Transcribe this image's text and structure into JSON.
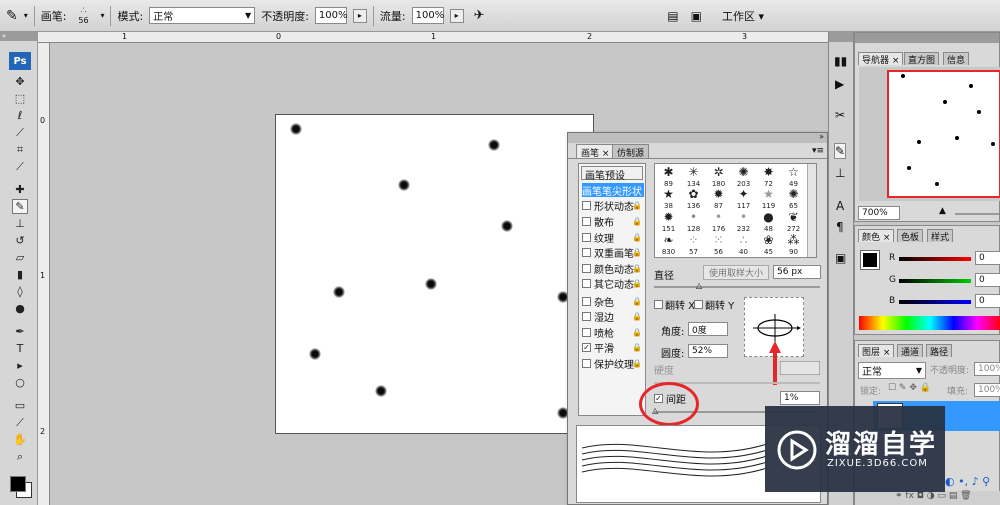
{
  "options_bar": {
    "brush_label": "画笔:",
    "brush_size": "56",
    "mode_label": "模式:",
    "mode_value": "正常",
    "opacity_label": "不透明度:",
    "opacity_value": "100%",
    "flow_label": "流量:",
    "flow_value": "100%",
    "workspace_label": "工作区 ▾"
  },
  "rulers": {
    "h_labels": [
      "1",
      "0",
      "1",
      "2",
      "3"
    ],
    "v_labels": [
      "0",
      "1",
      "2"
    ]
  },
  "toolbar": {
    "logo": "Ps",
    "tools": [
      "move-icon",
      "marquee-icon",
      "lasso-icon",
      "quick-select-icon",
      "crop-icon",
      "eyedropper-icon",
      "heal-icon",
      "brush-icon",
      "clone-stamp-icon",
      "history-brush-icon",
      "eraser-icon",
      "gradient-icon",
      "blur-icon",
      "dodge-icon",
      "pen-icon",
      "type-icon",
      "path-select-icon",
      "shape-icon",
      "notes-icon",
      "eyedropper2-icon",
      "hand-icon",
      "zoom-icon"
    ]
  },
  "brush_panel": {
    "tabs": [
      "画笔 ×",
      "仿制源"
    ],
    "preset_button": "画笔预设",
    "items": [
      {
        "label": "画笔笔尖形状",
        "checked": null,
        "selected": true
      },
      {
        "label": "形状动态",
        "checked": false
      },
      {
        "label": "散布",
        "checked": false
      },
      {
        "label": "纹理",
        "checked": false
      },
      {
        "label": "双重画笔",
        "checked": false
      },
      {
        "label": "颜色动态",
        "checked": false
      },
      {
        "label": "其它动态",
        "checked": false
      },
      {
        "label": "杂色",
        "checked": false
      },
      {
        "label": "湿边",
        "checked": false
      },
      {
        "label": "喷枪",
        "checked": false
      },
      {
        "label": "平滑",
        "checked": true
      },
      {
        "label": "保护纹理",
        "checked": false
      }
    ],
    "tips": [
      "89",
      "134",
      "180",
      "203",
      "72",
      "49",
      "38",
      "136",
      "87",
      "117",
      "119",
      "65",
      "151",
      "128",
      "176",
      "232",
      "48",
      "272",
      "830",
      "57",
      "56",
      "40",
      "45",
      "90"
    ],
    "diameter_label": "直径",
    "sample_size_button": "使用取样大小",
    "diameter_value": "56 px",
    "flip_x_label": "翻转 X",
    "flip_y_label": "翻转 Y",
    "angle_label": "角度:",
    "angle_value": "0度",
    "roundness_label": "圆度:",
    "roundness_value": "52%",
    "hardness_label": "硬度",
    "spacing_label": "间距",
    "spacing_checked": true,
    "spacing_value": "1%"
  },
  "navigator": {
    "tabs": [
      "导航器 ×",
      "直方图",
      "信息"
    ],
    "zoom": "700%"
  },
  "color_panel": {
    "tabs": [
      "颜色 ×",
      "色板",
      "样式"
    ],
    "r_label": "R",
    "g_label": "G",
    "b_label": "B",
    "r_value": "0",
    "g_value": "0",
    "b_value": "0"
  },
  "layers_panel": {
    "tabs": [
      "图层 ×",
      "通道",
      "路径"
    ],
    "blend_mode": "正常",
    "opacity_label": "不透明度:",
    "opacity_value": "100%",
    "lock_label": "锁定:",
    "fill_label": "填充:",
    "fill_value": "100%"
  },
  "watermark": {
    "title": "溜溜自学",
    "url": "ZIXUE.3D66.COM"
  },
  "colors": {
    "annotation_red": "#e8262a",
    "selection_blue": "#3399ff",
    "watermark_bg": "#2a3244"
  }
}
